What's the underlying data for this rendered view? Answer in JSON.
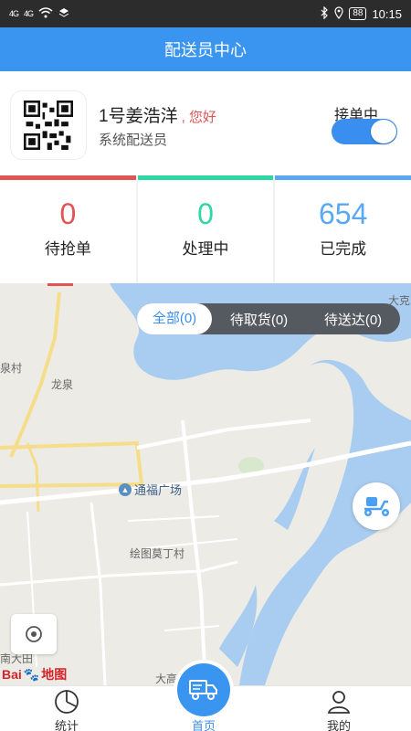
{
  "status_bar": {
    "signal1": "4G",
    "signal2": "4G",
    "battery": "88",
    "time": "10:15"
  },
  "header": {
    "title": "配送员中心"
  },
  "profile": {
    "name": "1号姜浩洋",
    "greeting": ", 您好",
    "role": "系统配送员",
    "toggle_label": "接单中",
    "toggle_on": true
  },
  "stats": [
    {
      "value": "0",
      "label": "待抢单",
      "color": "#e25353"
    },
    {
      "value": "0",
      "label": "处理中",
      "color": "#2fd6a6"
    },
    {
      "value": "654",
      "label": "已完成",
      "color": "#59a9f2"
    }
  ],
  "filter": {
    "options": [
      "全部(0)",
      "待取货(0)",
      "待送达(0)"
    ],
    "active_index": 0
  },
  "map": {
    "labels": {
      "village": "泉村",
      "longquan": "龙泉",
      "poi": "通福广场",
      "huitu": "绘图莫丁村",
      "nanda": "南大田",
      "dake": "大克",
      "dagao": "大高"
    },
    "logo": {
      "bai": "Bai",
      "du": "du",
      "map": "地图"
    }
  },
  "tabs": [
    {
      "label": "统计",
      "icon": "chart-pie-icon"
    },
    {
      "label": "首页",
      "icon": "delivery-truck-icon"
    },
    {
      "label": "我的",
      "icon": "user-icon"
    }
  ]
}
